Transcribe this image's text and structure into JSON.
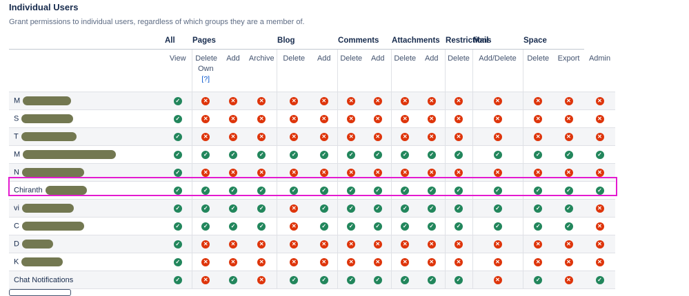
{
  "section": {
    "title": "Individual Users",
    "subtitle": "Grant permissions to individual users, regardless of which groups they are a member of."
  },
  "groups": [
    {
      "label": "All",
      "span": 1
    },
    {
      "label": "Pages",
      "span": 3
    },
    {
      "label": "Blog",
      "span": 2
    },
    {
      "label": "Comments",
      "span": 2
    },
    {
      "label": "Attachments",
      "span": 2
    },
    {
      "label": "Restrictions",
      "span": 1
    },
    {
      "label": "Mail",
      "span": 1
    },
    {
      "label": "Space",
      "span": 2
    }
  ],
  "columns": [
    {
      "label": "View"
    },
    {
      "label": "Delete Own",
      "help": "[?]"
    },
    {
      "label": "Add"
    },
    {
      "label": "Archive"
    },
    {
      "label": "Delete"
    },
    {
      "label": "Add"
    },
    {
      "label": "Delete"
    },
    {
      "label": "Add"
    },
    {
      "label": "Delete"
    },
    {
      "label": "Add"
    },
    {
      "label": "Delete"
    },
    {
      "label": "Add/Delete"
    },
    {
      "label": "Delete"
    },
    {
      "label": "Export"
    },
    {
      "label": "Admin"
    }
  ],
  "users": [
    {
      "name": "M",
      "redacted": true,
      "perms": [
        1,
        0,
        0,
        0,
        0,
        0,
        0,
        0,
        0,
        0,
        0,
        0,
        0,
        0,
        0
      ]
    },
    {
      "name": "S",
      "redacted": true,
      "perms": [
        1,
        0,
        0,
        0,
        0,
        0,
        0,
        0,
        0,
        0,
        0,
        0,
        0,
        0,
        0
      ]
    },
    {
      "name": "T",
      "redacted": true,
      "perms": [
        1,
        0,
        0,
        0,
        0,
        0,
        0,
        0,
        0,
        0,
        0,
        0,
        0,
        0,
        0
      ]
    },
    {
      "name": "M",
      "redacted": true,
      "perms": [
        1,
        1,
        1,
        1,
        1,
        1,
        1,
        1,
        1,
        1,
        1,
        1,
        1,
        1,
        1
      ]
    },
    {
      "name": "N",
      "redacted": true,
      "perms": [
        1,
        0,
        0,
        0,
        0,
        0,
        0,
        0,
        0,
        0,
        0,
        0,
        0,
        0,
        0
      ]
    },
    {
      "name": "Chiranth",
      "redacted": true,
      "highlighted": true,
      "perms": [
        1,
        1,
        1,
        1,
        1,
        1,
        1,
        1,
        1,
        1,
        1,
        1,
        1,
        1,
        1
      ]
    },
    {
      "name": "vi",
      "redacted": true,
      "perms": [
        1,
        1,
        1,
        1,
        0,
        1,
        1,
        1,
        1,
        1,
        1,
        1,
        1,
        1,
        0
      ]
    },
    {
      "name": "C",
      "redacted": true,
      "perms": [
        1,
        1,
        1,
        1,
        0,
        1,
        1,
        1,
        1,
        1,
        1,
        1,
        1,
        1,
        0
      ]
    },
    {
      "name": "D",
      "redacted": true,
      "perms": [
        1,
        0,
        0,
        0,
        0,
        0,
        0,
        0,
        0,
        0,
        0,
        0,
        0,
        0,
        0
      ]
    },
    {
      "name": "K",
      "redacted": true,
      "perms": [
        1,
        0,
        0,
        0,
        0,
        0,
        0,
        0,
        0,
        0,
        0,
        0,
        0,
        0,
        0
      ]
    },
    {
      "name": "Chat Notifications",
      "redacted": false,
      "perms": [
        1,
        0,
        1,
        0,
        1,
        1,
        1,
        1,
        1,
        1,
        1,
        0,
        1,
        0,
        1
      ]
    }
  ],
  "icons": {
    "granted": "check-icon",
    "denied": "cross-icon"
  },
  "colors": {
    "granted": "#22865c",
    "denied": "#de350b",
    "highlight": "#e41ad0"
  }
}
